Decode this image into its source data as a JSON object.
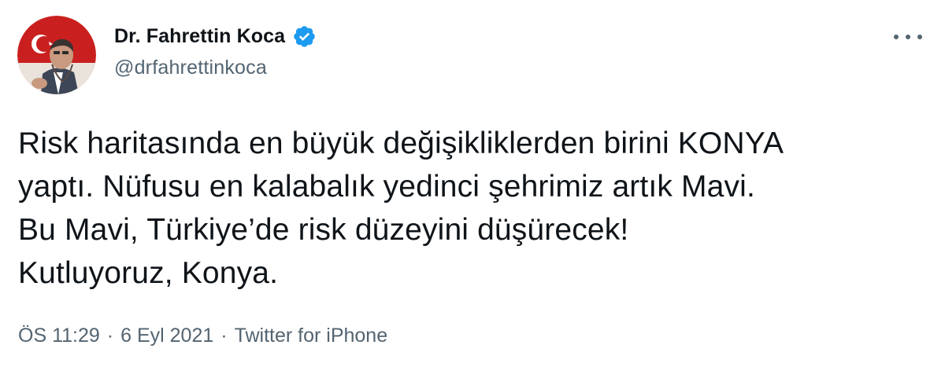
{
  "author": {
    "display_name": "Dr. Fahrettin Koca",
    "handle": "@drfahrettinkoca",
    "verified_icon": "verified-badge-icon",
    "avatar_icon": "profile-avatar"
  },
  "tweet": {
    "lines": [
      "Risk haritasında en büyük değişikliklerden birini KONYA",
      "yaptı. Nüfusu en kalabalık yedinci şehrimiz artık Mavi.",
      "Bu Mavi, Türkiye’de risk düzeyini düşürecek!",
      "Kutluyoruz, Konya."
    ]
  },
  "meta": {
    "time": "ÖS 11:29",
    "separator": "·",
    "date": "6 Eyl 2021",
    "source": "Twitter for iPhone"
  },
  "colors": {
    "text_primary": "#0f1419",
    "text_secondary": "#536471",
    "verified_blue": "#1d9bf0"
  },
  "more_icon": "more-options-icon"
}
